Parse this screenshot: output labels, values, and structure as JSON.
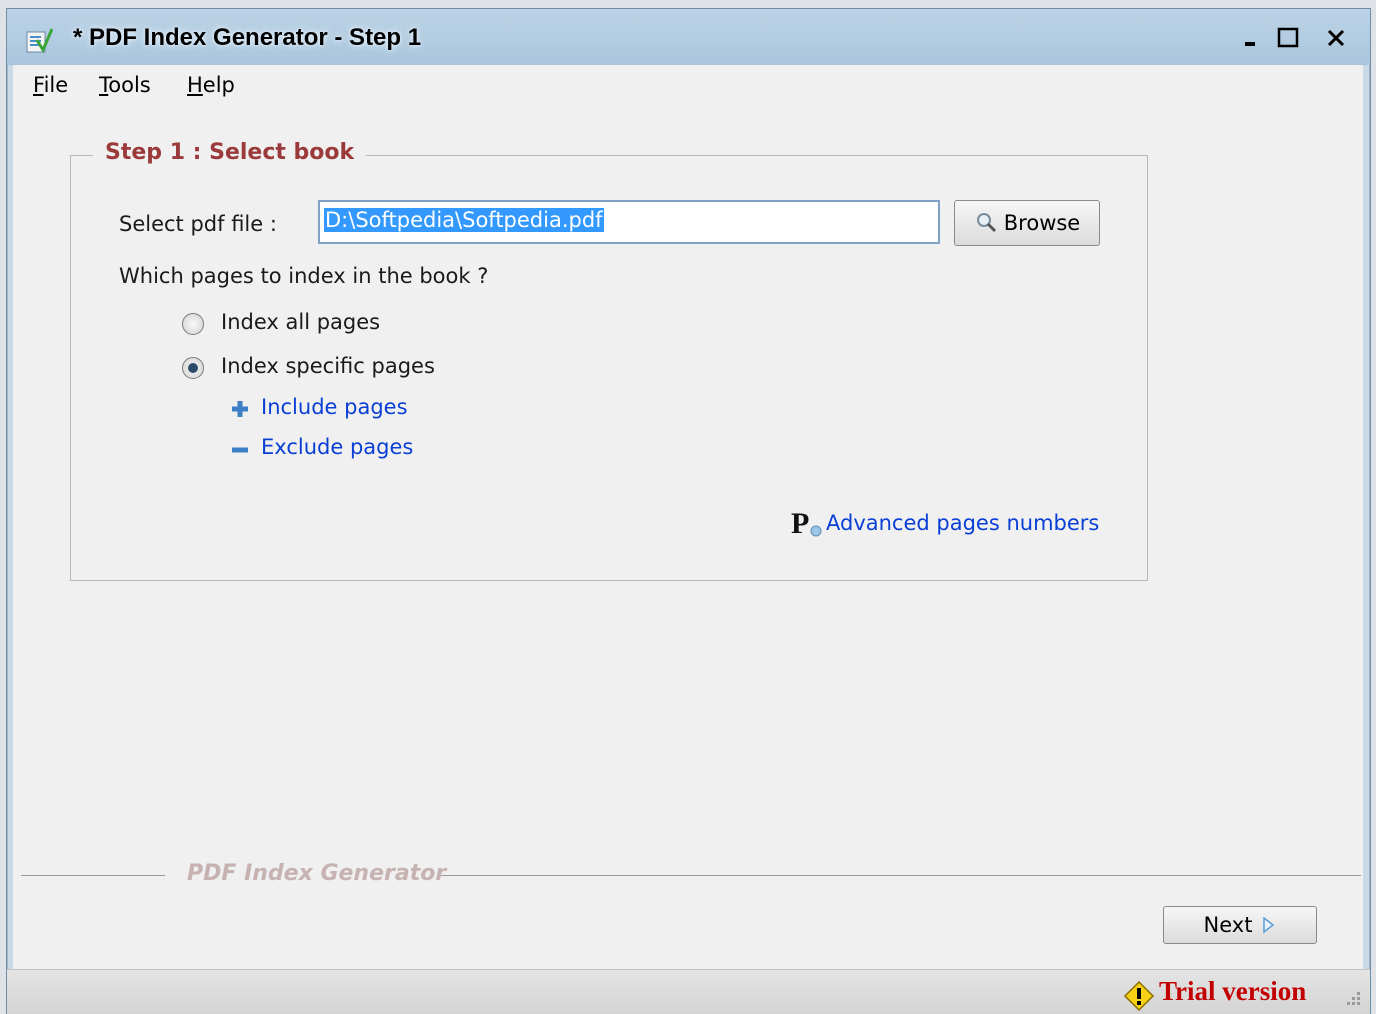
{
  "window": {
    "title": "* PDF Index Generator - Step 1",
    "controls": {
      "minimize": "minimize",
      "maximize": "maximize",
      "close": "close"
    }
  },
  "menu": {
    "items": [
      {
        "label": "File"
      },
      {
        "label": "Tools"
      },
      {
        "label": "Help"
      }
    ]
  },
  "step": {
    "title": "Step 1 : Select book",
    "file_label": "Select pdf file :",
    "file_value": "D:\\Softpedia\\Softpedia.pdf",
    "browse_label": "Browse",
    "pages_question": "Which pages to index in the book ?",
    "options": [
      {
        "label": "Index all pages",
        "checked": false
      },
      {
        "label": "Index specific pages",
        "checked": true
      }
    ],
    "include_label": "Include pages",
    "exclude_label": "Exclude pages",
    "advanced_label": "Advanced pages numbers"
  },
  "footer": {
    "brand": "PDF Index Generator",
    "next_label": "Next"
  },
  "status": {
    "trial_label": "Trial version"
  },
  "colors": {
    "group_title": "#9b3a3a",
    "link": "#0a3fd6",
    "trial": "#c30000",
    "selection": "#3399ff"
  }
}
